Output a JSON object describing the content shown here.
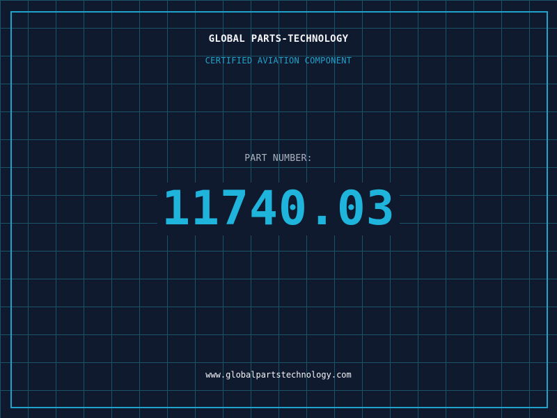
{
  "header": {
    "brand": "GLOBAL PARTS-TECHNOLOGY",
    "subtitle": "CERTIFIED AVIATION COMPONENT"
  },
  "main": {
    "label": "PART NUMBER:",
    "part_number": "11740.03"
  },
  "footer": {
    "url": "www.globalpartstechnology.com"
  },
  "colors": {
    "background": "#101a2e",
    "grid": "#1b5468",
    "accent": "#1fa3cc",
    "part_number": "#1fb4dc"
  }
}
